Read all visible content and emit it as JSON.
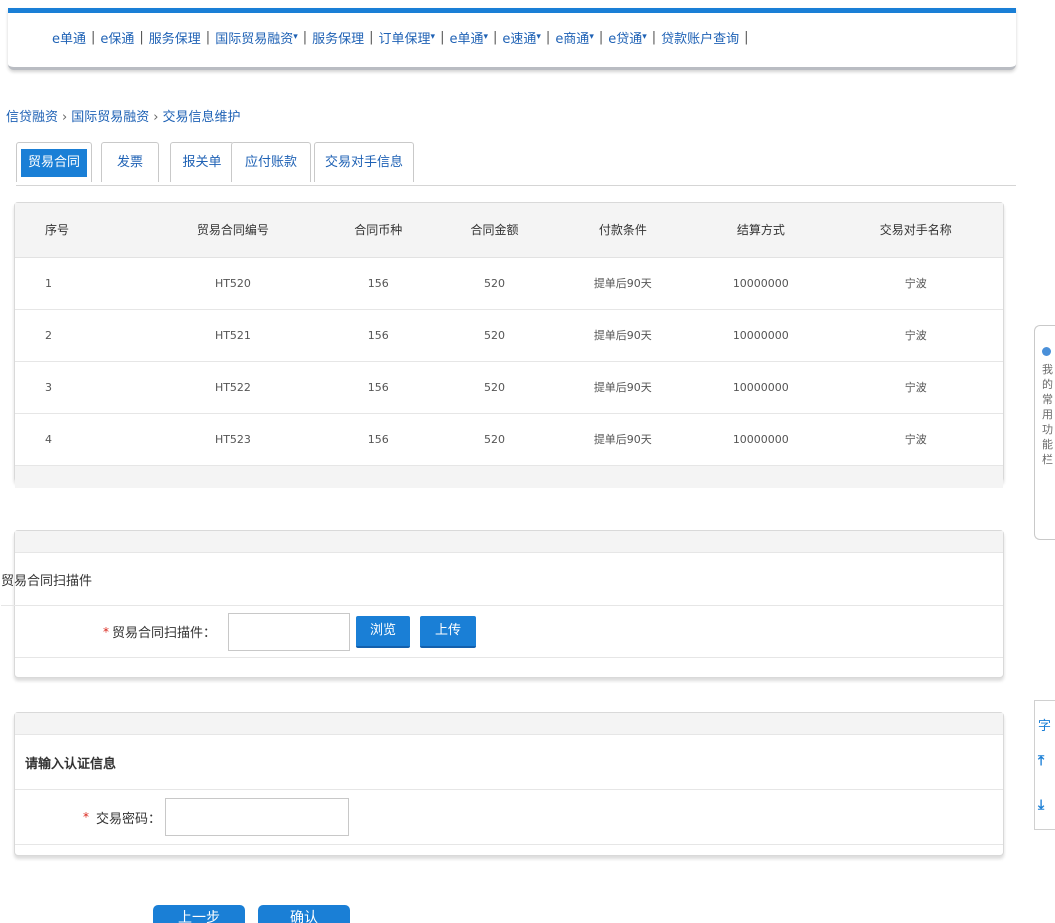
{
  "nav": {
    "items": [
      "e单通",
      "e保通",
      "服务保理",
      "国际贸易融资",
      "服务保理",
      "订单保理",
      "e单通",
      "e速通",
      "e商通",
      "e贷通",
      "贷款账户查询"
    ],
    "dropdown_mark": "▾"
  },
  "breadcrumb": [
    "信贷融资",
    "国际贸易融资",
    "交易信息维护"
  ],
  "tabs": [
    {
      "label": "贸易合同",
      "active": true
    },
    {
      "label": "发票",
      "active": false
    },
    {
      "label": "报关单",
      "active": false
    },
    {
      "label": "应付账款",
      "active": false
    },
    {
      "label": "交易对手信息",
      "active": false
    }
  ],
  "contract_table": {
    "headers": [
      "序号",
      "贸易合同编号",
      "合同币种",
      "合同金额",
      "付款条件",
      "结算方式",
      "交易对手名称"
    ],
    "rows": [
      [
        "1",
        "HT520",
        "156",
        "520",
        "提单后90天",
        "10000000",
        "宁波"
      ],
      [
        "2",
        "HT521",
        "156",
        "520",
        "提单后90天",
        "10000000",
        "宁波"
      ],
      [
        "3",
        "HT522",
        "156",
        "520",
        "提单后90天",
        "10000000",
        "宁波"
      ],
      [
        "4",
        "HT523",
        "156",
        "520",
        "提单后90天",
        "10000000",
        "宁波"
      ]
    ]
  },
  "scan_section": {
    "title": "贸易合同扫描件",
    "required_mark": "*",
    "field_label": "贸易合同扫描件：",
    "file_value": "",
    "browse_label": "浏览",
    "upload_label": "上传"
  },
  "auth_section": {
    "title": "请输入认证信息",
    "required_mark": "*",
    "field_label": "交易密码：",
    "password_value": ""
  },
  "footer_buttons": {
    "prev_label": "上一步",
    "confirm_label": "确认"
  },
  "side_widget": {
    "favorites_text": "我的常用功能栏",
    "font_label": "字",
    "up_icon": "arrow-up-icon",
    "down_icon": "arrow-down-icon"
  }
}
